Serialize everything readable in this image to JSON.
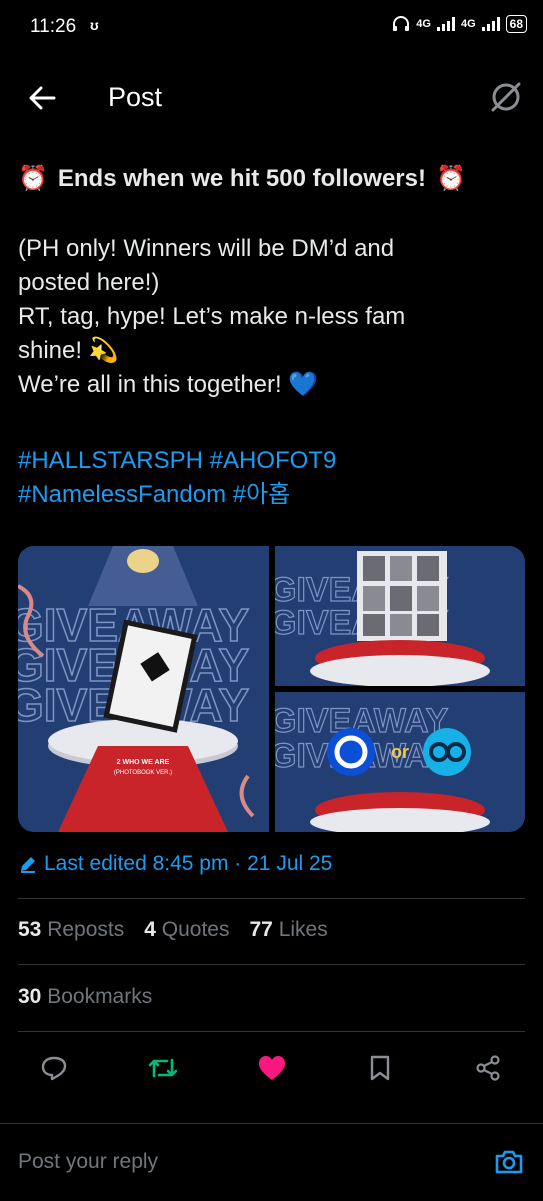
{
  "status_bar": {
    "time": "11:26",
    "vibrate": "ʊ",
    "network1": "4G",
    "network2": "4G",
    "battery": "68"
  },
  "header": {
    "title": "Post"
  },
  "post": {
    "headline": "Ends when we hit 500 followers!",
    "headline_emoji": "⏰",
    "lines": [
      "(PH only! Winners will be DM’d and",
      "posted here!)",
      "RT, tag, hype! Let’s make n-less fam",
      "shine! 💫",
      "We’re all in this together! 💙"
    ],
    "hashtag_line1": "#HALLSTARSPH #AHOFOT9",
    "hashtag_line2": "#NamelessFandom #아홉"
  },
  "media": {
    "tile1_caption": "2 WHO WE ARE",
    "tile1_sub": "(PHOTOBOOK VER.)",
    "tile3_or": "or",
    "bg_word": "GIVEAWAY"
  },
  "meta": {
    "edited": "Last edited 8:45 pm · 21 Jul 25"
  },
  "stats": {
    "reposts_count": "53",
    "reposts_label": "Reposts",
    "quotes_count": "4",
    "quotes_label": "Quotes",
    "likes_count": "77",
    "likes_label": "Likes",
    "bookmarks_count": "30",
    "bookmarks_label": "Bookmarks"
  },
  "reply": {
    "placeholder": "Post your reply"
  },
  "colors": {
    "accent": "#1d9bf0",
    "repost_active": "#00ba7c",
    "like_active": "#f91880"
  }
}
